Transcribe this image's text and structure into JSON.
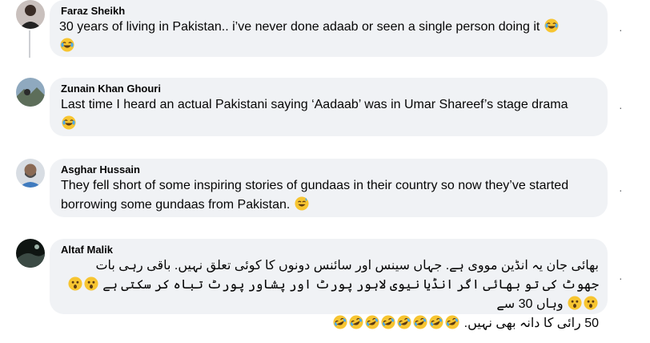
{
  "comments": [
    {
      "author": "Faraz Sheikh",
      "text": "30 years of living in Pakistan.. i’ve never done adaab or seen a single person doing it",
      "emojis": [
        "face-with-tears-of-joy-emoji",
        "face-with-tears-of-joy-emoji"
      ]
    },
    {
      "author": "Zunain Khan Ghouri",
      "text": "Last time I heard an actual Pakistani saying ‘Aadaab’ was in Umar Shareef’s stage drama",
      "emojis": [
        "face-with-tears-of-joy-emoji"
      ]
    },
    {
      "author": "Asghar Hussain",
      "text": "They fell short of some inspiring stories of gundaas in their country so now they’ve started borrowing some gundaas from Pakistan.",
      "emojis": [
        "grinning-face-with-sweat-emoji"
      ]
    },
    {
      "author": "Altaf Malik",
      "line1": "بھائی جان یہ انڈین مووی ہے. جہاں سینس اور سائنس دونوں کا کوئی تعلق نہیں. باقی رہی بات",
      "line2": "جھوٹ کی تو بھائی اگر انڈیا نیوی لاہور پورٹ اور پشاور پورٹ تباہ کر سکتی ہے",
      "line2b": "وہاں 30 سے",
      "line3": "50 رائی کا دانہ بھی نہیں.",
      "emojis_line2": [
        "astonished-face-emoji",
        "astonished-face-emoji",
        "astonished-face-emoji",
        "astonished-face-emoji"
      ],
      "emojis_line3": [
        "rolling-on-floor-laughing-emoji",
        "rolling-on-floor-laughing-emoji",
        "rolling-on-floor-laughing-emoji",
        "rolling-on-floor-laughing-emoji",
        "rolling-on-floor-laughing-emoji",
        "rolling-on-floor-laughing-emoji",
        "rolling-on-floor-laughing-emoji",
        "rolling-on-floor-laughing-emoji"
      ]
    }
  ],
  "more_options_glyph": "·"
}
